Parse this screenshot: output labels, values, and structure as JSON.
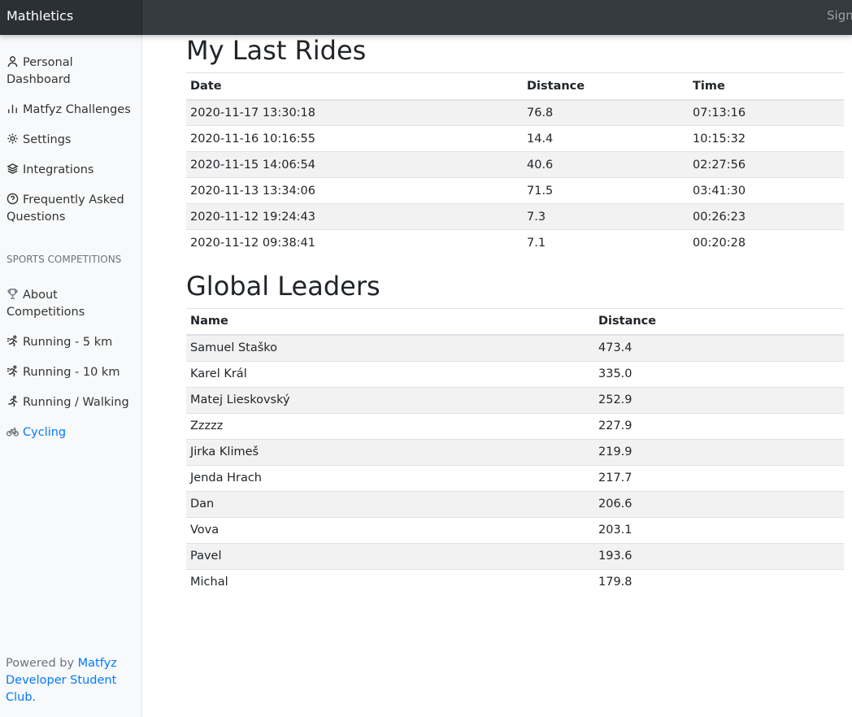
{
  "app": {
    "brand": "Mathletics",
    "sign_out": "Sign out"
  },
  "sidebar": {
    "items": [
      {
        "label": "Personal Dashboard",
        "icon": "user-icon"
      },
      {
        "label": "Matfyz Challenges",
        "icon": "bar-chart-icon"
      },
      {
        "label": "Settings",
        "icon": "gear-icon"
      },
      {
        "label": "Integrations",
        "icon": "layers-icon"
      },
      {
        "label": "Frequently Asked Questions",
        "icon": "help-circle-icon"
      }
    ],
    "section_heading": "Sports Competitions",
    "competitions": [
      {
        "label": "About Competitions",
        "icon": "trophy-icon"
      },
      {
        "label": "Running - 5 km",
        "icon": "running-fast-icon"
      },
      {
        "label": "Running - 10 km",
        "icon": "running-fast-icon"
      },
      {
        "label": "Running / Walking",
        "icon": "running-icon"
      },
      {
        "label": "Cycling",
        "icon": "bicycle-icon",
        "active": true
      }
    ],
    "footer": {
      "prefix": "Powered by ",
      "link": "Matfyz Developer Student Club."
    }
  },
  "rides": {
    "title": "My Last Rides",
    "columns": [
      "Date",
      "Distance",
      "Time"
    ],
    "rows": [
      [
        "2020-11-17 13:30:18",
        "76.8",
        "07:13:16"
      ],
      [
        "2020-11-16 10:16:55",
        "14.4",
        "10:15:32"
      ],
      [
        "2020-11-15 14:06:54",
        "40.6",
        "02:27:56"
      ],
      [
        "2020-11-13 13:34:06",
        "71.5",
        "03:41:30"
      ],
      [
        "2020-11-12 19:24:43",
        "7.3",
        "00:26:23"
      ],
      [
        "2020-11-12 09:38:41",
        "7.1",
        "00:20:28"
      ]
    ]
  },
  "leaders": {
    "title": "Global Leaders",
    "columns": [
      "Name",
      "Distance"
    ],
    "rows": [
      [
        "Samuel Staško",
        "473.4"
      ],
      [
        "Karel Král",
        "335.0"
      ],
      [
        "Matej Lieskovský",
        "252.9"
      ],
      [
        "Zzzzz",
        "227.9"
      ],
      [
        "Jirka Klimeš",
        "219.9"
      ],
      [
        "Jenda Hrach",
        "217.7"
      ],
      [
        "Dan",
        "206.6"
      ],
      [
        "Vova",
        "203.1"
      ],
      [
        "Pavel",
        "193.6"
      ],
      [
        "Michal",
        "179.8"
      ]
    ]
  },
  "colors": {
    "link": "#007bff",
    "navbar": "#343a40",
    "sidebar": "#f8f9fa"
  }
}
